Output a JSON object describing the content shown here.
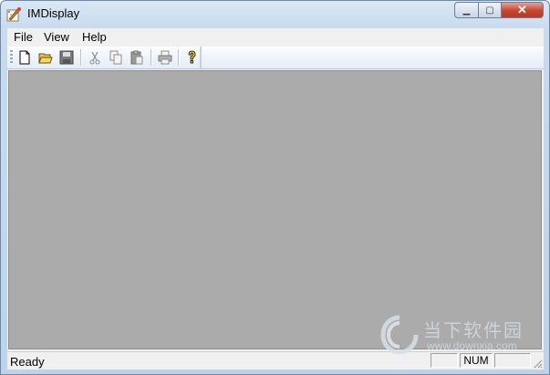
{
  "window": {
    "title": "IMDisplay"
  },
  "controls": {
    "minimize": "▁",
    "maximize": "▢",
    "close": "✕"
  },
  "menu": {
    "items": [
      "File",
      "View",
      "Help"
    ]
  },
  "toolbar": {
    "buttons": [
      "new-icon",
      "open-icon",
      "save-icon",
      "cut-icon",
      "copy-icon",
      "paste-icon",
      "print-icon",
      "help-icon"
    ]
  },
  "statusbar": {
    "text": "Ready",
    "indicators": [
      "",
      "NUM",
      ""
    ]
  },
  "watermark": {
    "name": "当下软件园",
    "url": "www.downxia.com"
  },
  "colors": {
    "canvas": "#ababab",
    "close_button": "#c7442f"
  }
}
